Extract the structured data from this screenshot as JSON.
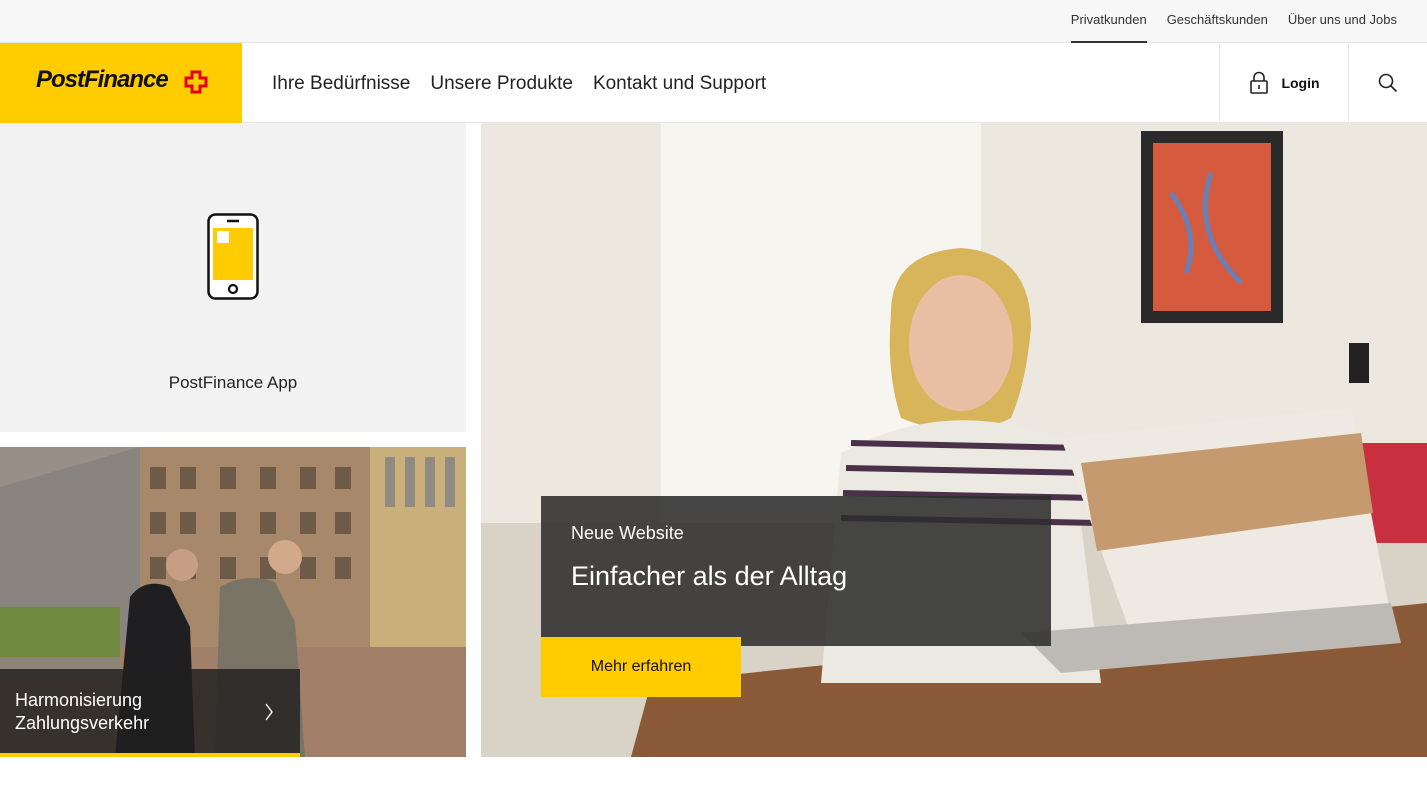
{
  "topbar": {
    "links": [
      "Privatkunden",
      "Geschäftskunden",
      "Über uns und Jobs"
    ],
    "active": "Privatkunden"
  },
  "header": {
    "logo_text": "PostFinance",
    "nav": [
      "Ihre Bedürfnisse",
      "Unsere Produkte",
      "Kontakt und Support"
    ],
    "login_label": "Login"
  },
  "app_card": {
    "label": "PostFinance App",
    "icon": "smartphone-icon"
  },
  "promo_card": {
    "title_line1": "Harmonisierung",
    "title_line2": "Zahlungsverkehr"
  },
  "hero": {
    "subtitle": "Neue Website",
    "title": "Einfacher als der Alltag",
    "cta": "Mehr erfahren"
  },
  "colors": {
    "brand_yellow": "#ffcc00",
    "brand_red": "#e3001b",
    "overlay_dark": "#2d2d2d"
  }
}
